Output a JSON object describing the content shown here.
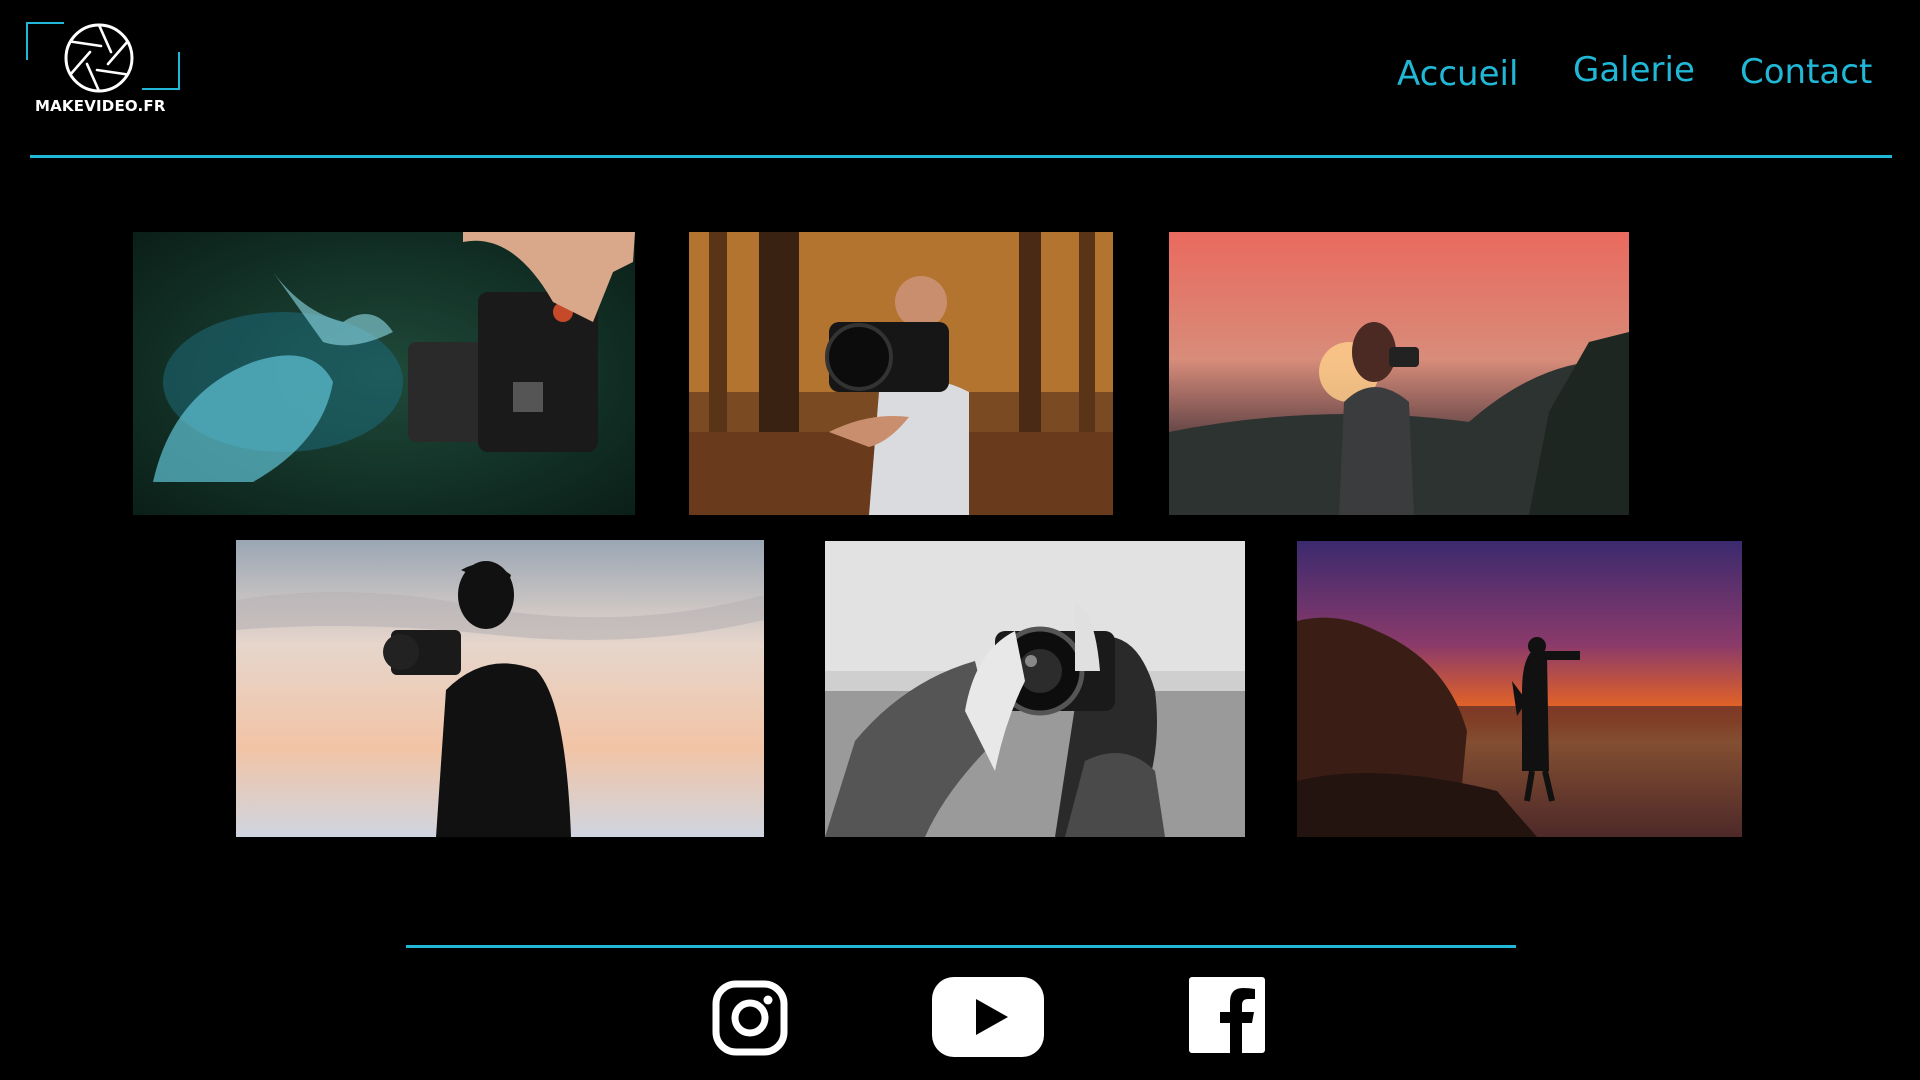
{
  "brand": {
    "name": "MAKEVIDEO.FR",
    "accent_color": "#20b8d6"
  },
  "nav": {
    "items": [
      {
        "label": "Accueil"
      },
      {
        "label": "Galerie"
      },
      {
        "label": "Contact"
      }
    ]
  },
  "gallery": {
    "photos": [
      {
        "subject": "camera-water-splash"
      },
      {
        "subject": "floating-camera-forest"
      },
      {
        "subject": "woman-photographer-sunset"
      },
      {
        "subject": "silhouette-photographer-sky"
      },
      {
        "subject": "woman-camera-black-white"
      },
      {
        "subject": "photographer-rocks-sea-sunset"
      }
    ]
  },
  "footer": {
    "social_icons": [
      "instagram-icon",
      "youtube-icon",
      "facebook-icon"
    ]
  }
}
